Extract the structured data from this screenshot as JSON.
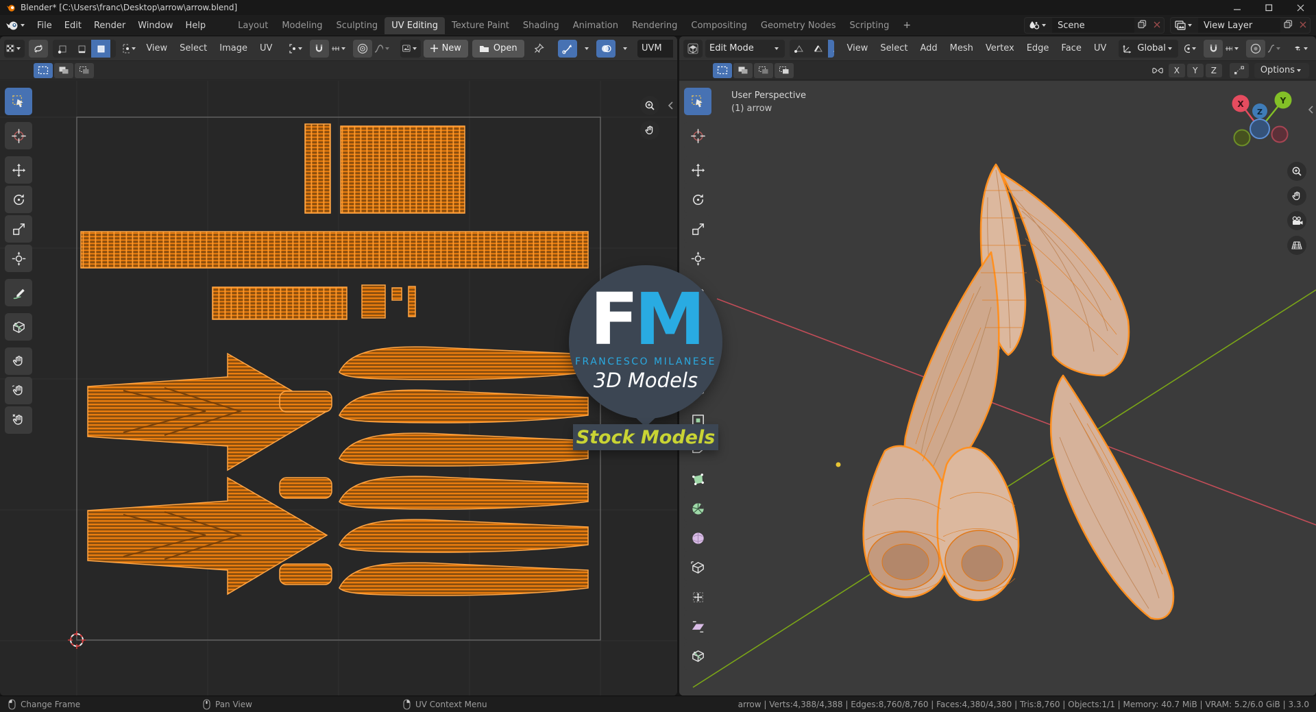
{
  "titlebar": {
    "title": "Blender* [C:\\Users\\franc\\Desktop\\arrow\\arrow.blend]"
  },
  "menubar": {
    "menus": [
      "File",
      "Edit",
      "Render",
      "Window",
      "Help"
    ],
    "workspaces": [
      "Layout",
      "Modeling",
      "Sculpting",
      "UV Editing",
      "Texture Paint",
      "Shading",
      "Animation",
      "Rendering",
      "Compositing",
      "Geometry Nodes",
      "Scripting"
    ],
    "active_workspace": "UV Editing",
    "add_workspace": "+",
    "scene_label": "Scene",
    "view_layer_label": "View Layer"
  },
  "uv_editor": {
    "menus": [
      "View",
      "Select",
      "Image",
      "UV"
    ],
    "new_label": "New",
    "open_label": "Open",
    "uv_map_label": "UVM",
    "active_select_mode": "face",
    "tools": [
      "tweak",
      "cursor",
      "move",
      "rotate",
      "scale",
      "transform",
      "annotate",
      "rip-region",
      "grab",
      "relax",
      "pinch"
    ],
    "header_icons": [
      "editor-type",
      "uv-sync-select",
      "select-vertex",
      "select-edge",
      "select-face",
      "select-island",
      "sticky-select",
      "pivot",
      "snap",
      "snap-target",
      "proportional-edit",
      "falloff",
      "browse-image",
      "pin",
      "gizmo-toggle",
      "overlays-toggle"
    ],
    "nav_icons": [
      "zoom",
      "pan"
    ]
  },
  "viewport3d": {
    "mode_label": "Edit Mode",
    "menus": [
      "View",
      "Select",
      "Add",
      "Mesh",
      "Vertex",
      "Edge",
      "Face",
      "UV"
    ],
    "orientation_label": "Global",
    "axes": [
      "X",
      "Y",
      "Z"
    ],
    "options_label": "Options",
    "overlay_line1": "User Perspective",
    "overlay_line2": "(1) arrow",
    "active_select_mode": "face",
    "tools": [
      "tweak",
      "cursor",
      "move",
      "rotate",
      "scale",
      "transform",
      "annotate",
      "measure",
      "add-cube",
      "extrude-region",
      "inset-faces",
      "bevel",
      "poly-build",
      "spin",
      "smooth",
      "edge-slide",
      "shrink-fatten",
      "shear",
      "rip-region"
    ],
    "header_icons": [
      "editor-type",
      "select-vertex",
      "select-edge",
      "select-face",
      "orientation",
      "pivot",
      "snap",
      "snap-target",
      "proportional-edit",
      "falloff",
      "visibility"
    ],
    "nav_icons": [
      "zoom",
      "pan",
      "camera",
      "perspective"
    ],
    "gizmo": {
      "x": "X",
      "y": "Y",
      "z": "Z"
    }
  },
  "watermark": {
    "f": "F",
    "m": "M",
    "name": "FRANCESCO MILANESE",
    "subtitle": "3D Models",
    "badge": "Stock Models"
  },
  "statusbar": {
    "hints": [
      "Change Frame",
      "Pan View",
      "UV Context Menu"
    ],
    "stats": "arrow | Verts:4,388/4,388 | Edges:8,760/8,760 | Faces:4,380/4,380 | Tris:8,760 | Objects:1/1 | Memory: 40.7 MiB | VRAM: 5.2/6.0 GiB | 3.3.0"
  },
  "colors": {
    "accent_blue": "#4772b3",
    "uv_orange": "#f5830f",
    "uv_outline": "#ffa646",
    "axis_x_red": "#c24d58",
    "axis_y_green": "#7ba617",
    "gizmo_x": "#e54c5f",
    "gizmo_y": "#83c027",
    "gizmo_z": "#3f7cb8",
    "watermark_blue": "#29abe2",
    "badge_yellow": "#c9d434"
  }
}
